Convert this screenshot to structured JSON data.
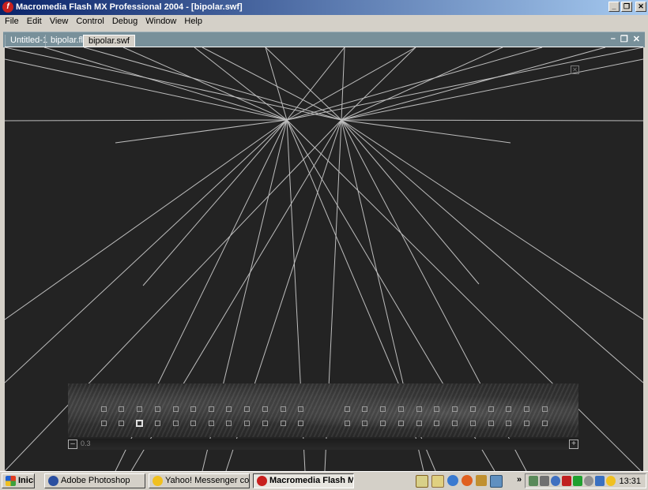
{
  "window": {
    "title": "Macromedia Flash MX Professional 2004 - [bipolar.swf]",
    "app_icon_glyph": "f",
    "buttons": {
      "minimize": "_",
      "restore": "❐",
      "close": "✕"
    }
  },
  "menu": [
    "File",
    "Edit",
    "View",
    "Control",
    "Debug",
    "Window",
    "Help"
  ],
  "doc_tabs": [
    {
      "label": "Untitled-1",
      "active": false
    },
    {
      "label": "bipolar.fla",
      "active": false
    },
    {
      "label": "bipolar.swf",
      "active": true
    }
  ],
  "doc_controls": {
    "minimize": "–",
    "restore": "❐",
    "close": "✕"
  },
  "stage": {
    "background": "#232323",
    "line_color": "#bdbdbd",
    "close_glyph": "✕"
  },
  "thumbnails": {
    "rows": 2,
    "selected_row": 2,
    "selected_index": 3
  },
  "zoom": {
    "minus": "–",
    "value": "0.3",
    "plus": "+"
  },
  "taskbar": {
    "start_label": "Inicio",
    "buttons": [
      {
        "label": "Adobe Photoshop",
        "icon": "photoshop-icon"
      },
      {
        "label": "Yahoo! Messenger con Voz",
        "icon": "yahoo-messenger-icon"
      },
      {
        "label": "Macromedia Flash MX...",
        "icon": "flash-icon",
        "pressed": true
      }
    ],
    "overflow": "»",
    "clock": "13:31"
  }
}
